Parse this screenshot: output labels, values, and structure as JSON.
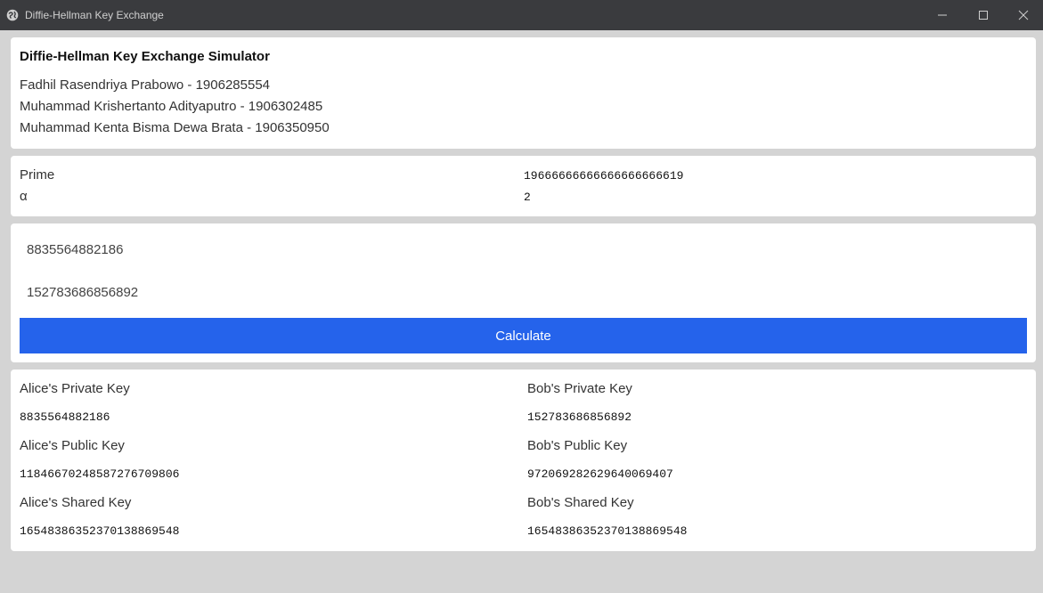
{
  "window": {
    "title": "Diffie-Hellman Key Exchange"
  },
  "header": {
    "title": "Diffie-Hellman Key Exchange Simulator",
    "authors": [
      "Fadhil Rasendriya Prabowo - 1906285554",
      "Muhammad Krishertanto Adityaputro - 1906302485",
      "Muhammad Kenta Bisma Dewa Brata - 1906350950"
    ]
  },
  "params": {
    "prime_label": "Prime",
    "prime_value": "19666666666666666666619",
    "alpha_label": "α",
    "alpha_value": "2"
  },
  "inputs": {
    "alice_private": "8835564882186",
    "bob_private": "152783686856892",
    "calculate_label": "Calculate"
  },
  "results": {
    "alice": {
      "private_label": "Alice's Private Key",
      "private_value": "8835564882186",
      "public_label": "Alice's Public Key",
      "public_value": "11846670248587276709806",
      "shared_label": "Alice's Shared Key",
      "shared_value": "16548386352370138869548"
    },
    "bob": {
      "private_label": "Bob's Private Key",
      "private_value": "152783686856892",
      "public_label": "Bob's Public Key",
      "public_value": "9720692826296400694​07",
      "shared_label": "Bob's Shared Key",
      "shared_value": "16548386352370138869548"
    }
  },
  "colors": {
    "titlebar": "#3a3b3e",
    "background": "#d4d4d4",
    "card": "#ffffff",
    "button": "#2563eb"
  },
  "icons": {
    "app": "globe-icon",
    "minimize": "minimize-icon",
    "maximize": "maximize-icon",
    "close": "close-icon"
  }
}
